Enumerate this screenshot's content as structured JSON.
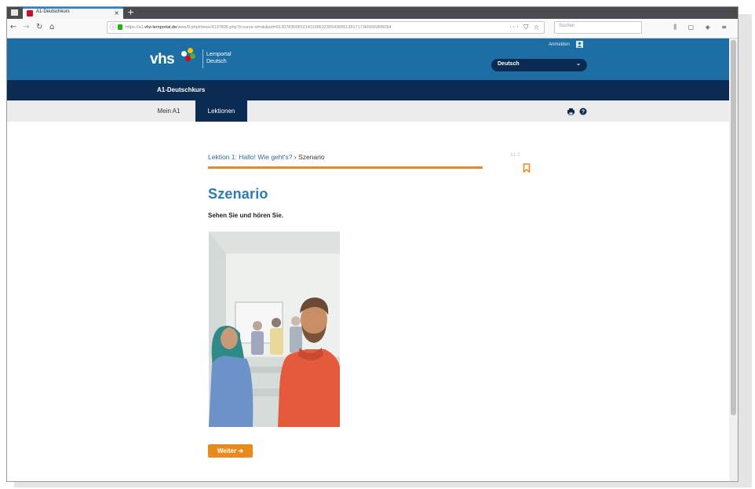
{
  "browser": {
    "tab_title": "A1-Deutschkurs",
    "tab_close": "×",
    "new_tab": "+",
    "url_prefix": "https://a1.",
    "url_domain": "vhs-lernportal.de",
    "url_rest": "/wws/9.php#/wws/4137896.php?/course-id=ab&sid=613078300652141108632355435551391717366916895094",
    "url_icons": "··· ⛉ ☆",
    "search_placeholder": "Suchen",
    "tools": "⫼ ▢ ◈ ≡"
  },
  "site": {
    "logo": "vhs",
    "logo_line1": "Lernportal",
    "logo_line2": "Deutsch",
    "login": "Anmelden",
    "language": "Deutsch",
    "course": "A1-Deutschkurs",
    "tabs": [
      "Mein A1",
      "Lektionen"
    ],
    "active_tab": "Lektionen"
  },
  "content": {
    "breadcrumb_link": "Lektion 1: Hallo! Wie geht's?",
    "breadcrumb_sep": "›",
    "breadcrumb_current": "Szenario",
    "level": "A1-2",
    "heading": "Szenario",
    "instruction": "Sehen Sie und hören Sie.",
    "button": "Weiter ➔"
  },
  "colors": {
    "header_blue": "#1d6ea5",
    "navy": "#0b2b52",
    "accent_orange": "#e98a1d",
    "heading_blue": "#2a7bb6"
  }
}
